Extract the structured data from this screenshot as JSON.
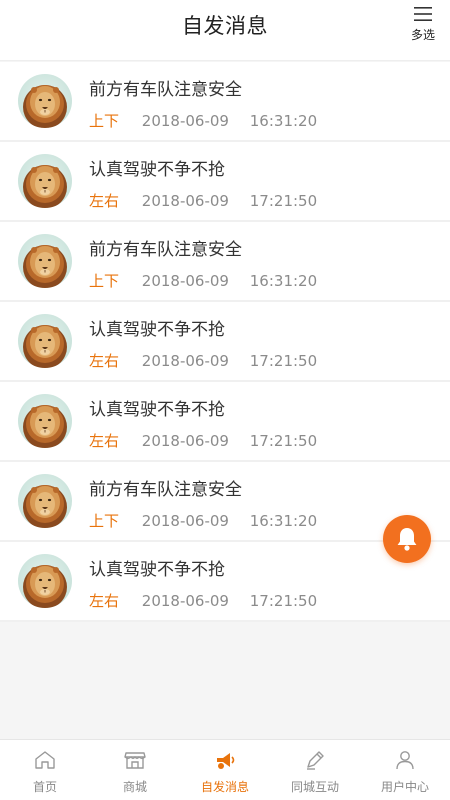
{
  "header": {
    "title": "自发消息",
    "multi_select_label": "多选",
    "menu_icon": "menu-icon"
  },
  "messages": [
    {
      "title": "前方有车队注意安全",
      "direction": "上下",
      "date": "2018-06-09",
      "time": "16:31:20",
      "avatar": "lion-avatar"
    },
    {
      "title": "认真驾驶不争不抢",
      "direction": "左右",
      "date": "2018-06-09",
      "time": "17:21:50",
      "avatar": "lion-avatar"
    },
    {
      "title": "前方有车队注意安全",
      "direction": "上下",
      "date": "2018-06-09",
      "time": "16:31:20",
      "avatar": "lion-avatar"
    },
    {
      "title": "认真驾驶不争不抢",
      "direction": "左右",
      "date": "2018-06-09",
      "time": "17:21:50",
      "avatar": "lion-avatar"
    },
    {
      "title": "认真驾驶不争不抢",
      "direction": "左右",
      "date": "2018-06-09",
      "time": "17:21:50",
      "avatar": "lion-avatar"
    },
    {
      "title": "前方有车队注意安全",
      "direction": "上下",
      "date": "2018-06-09",
      "time": "16:31:20",
      "avatar": "lion-avatar"
    },
    {
      "title": "认真驾驶不争不抢",
      "direction": "左右",
      "date": "2018-06-09",
      "time": "17:21:50",
      "avatar": "lion-avatar"
    }
  ],
  "fab": {
    "icon": "bell-icon"
  },
  "tabs": [
    {
      "label": "首页",
      "icon": "home-icon",
      "active": false
    },
    {
      "label": "商城",
      "icon": "store-icon",
      "active": false
    },
    {
      "label": "自发消息",
      "icon": "horn-icon",
      "active": true
    },
    {
      "label": "同城互动",
      "icon": "pen-icon",
      "active": false
    },
    {
      "label": "用户中心",
      "icon": "user-icon",
      "active": false
    }
  ],
  "colors": {
    "accent": "#e8730c",
    "fab": "#f2701f",
    "text_primary": "#333333",
    "text_secondary": "#8b8b8b"
  }
}
